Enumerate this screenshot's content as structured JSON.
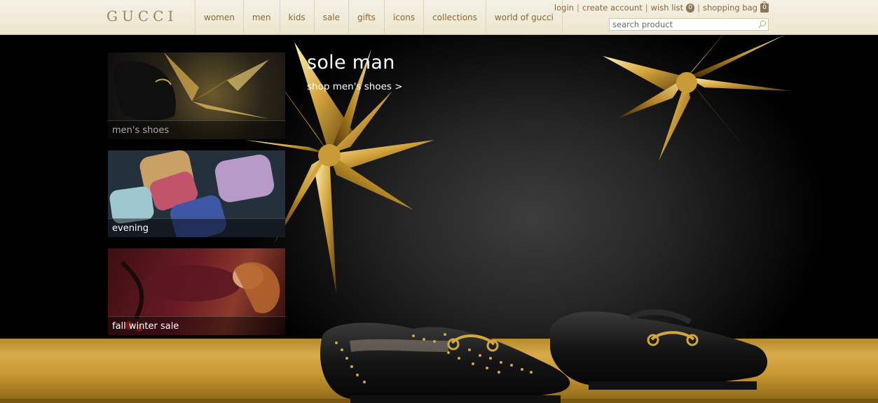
{
  "brand": {
    "logo": "GUCCI"
  },
  "nav": {
    "items": [
      {
        "label": "women"
      },
      {
        "label": "men"
      },
      {
        "label": "kids"
      },
      {
        "label": "sale"
      },
      {
        "label": "gifts"
      },
      {
        "label": "icons"
      },
      {
        "label": "collections"
      },
      {
        "label": "world of gucci"
      }
    ]
  },
  "utility": {
    "login": "login",
    "create_account": "create account",
    "wish_list": "wish list",
    "wish_list_count": "0",
    "shopping_bag": "shopping bag",
    "bag_count": "0",
    "separator": "|"
  },
  "search": {
    "placeholder": "search product",
    "icon": "search-icon"
  },
  "hero": {
    "title": "sole man",
    "link": "shop men's shoes >"
  },
  "tiles": [
    {
      "label": "men's shoes"
    },
    {
      "label": "evening"
    },
    {
      "label": "fall winter sale"
    }
  ],
  "colors": {
    "header_bg": "#efe9d6",
    "nav_text": "#86683d",
    "logo": "#9e8555",
    "gold": "#c89831"
  }
}
